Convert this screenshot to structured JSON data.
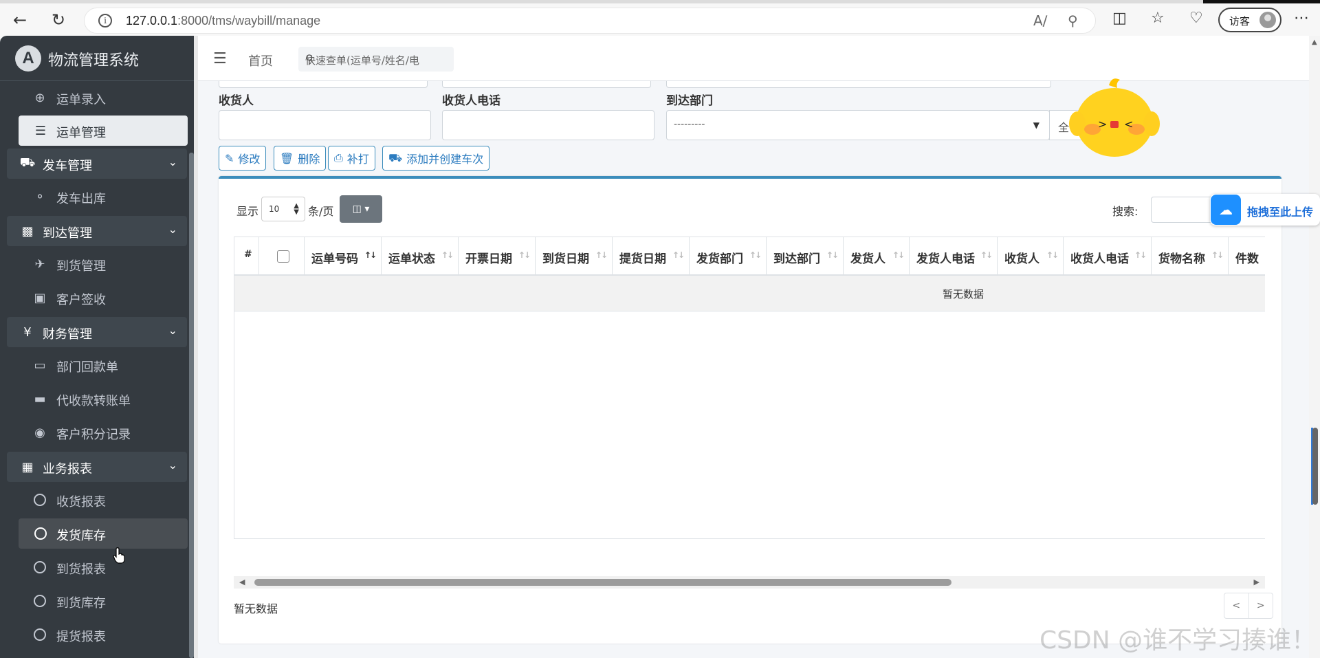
{
  "browser": {
    "url_host": "127.0.0.1",
    "url_path": ":8000/tms/waybill/manage",
    "guest_label": "访客"
  },
  "sidebar": {
    "brand": "物流管理系统",
    "items": [
      {
        "label": "运单录入",
        "icon": "plus-circle-icon"
      },
      {
        "label": "运单管理",
        "icon": "list-icon"
      },
      {
        "label": "发车管理",
        "icon": "truck-icon"
      },
      {
        "label": "发车出库",
        "icon": "vehicle-icon"
      },
      {
        "label": "到达管理",
        "icon": "dolly-icon"
      },
      {
        "label": "到货管理",
        "icon": "plane-landing-icon"
      },
      {
        "label": "客户签收",
        "icon": "box-open-icon"
      },
      {
        "label": "财务管理",
        "icon": "yen-icon"
      },
      {
        "label": "部门回款单",
        "icon": "money-bill-icon"
      },
      {
        "label": "代收款转账单",
        "icon": "credit-card-icon"
      },
      {
        "label": "客户积分记录",
        "icon": "coin-hand-icon"
      },
      {
        "label": "业务报表",
        "icon": "table-icon"
      },
      {
        "label": "收货报表",
        "icon": "circle-icon"
      },
      {
        "label": "发货库存",
        "icon": "circle-icon"
      },
      {
        "label": "到货报表",
        "icon": "circle-icon"
      },
      {
        "label": "到货库存",
        "icon": "circle-icon"
      },
      {
        "label": "提货报表",
        "icon": "circle-icon"
      }
    ]
  },
  "topnav": {
    "home": "首页",
    "quick_search_placeholder": "快速查单(运单号/姓名/电"
  },
  "filters": {
    "consignee_label": "收货人",
    "consignee_phone_label": "收货人电话",
    "arrival_dept_label": "到达部门",
    "arrival_dept_value": "---------",
    "all_button": "全"
  },
  "actions": {
    "edit": "修改",
    "delete": "删除",
    "reprint": "补打",
    "add_and_create_trip": "添加并创建车次"
  },
  "table": {
    "show_label": "显示",
    "page_size": "10",
    "per_page_label": "条/页",
    "search_label": "搜索:",
    "columns": [
      "#",
      "",
      "运单号码",
      "运单状态",
      "开票日期",
      "到货日期",
      "提货日期",
      "发货部门",
      "到达部门",
      "发货人",
      "发货人电话",
      "收货人",
      "收货人电话",
      "货物名称",
      "件数"
    ],
    "empty_row": "暂无数据",
    "footer_info": "暂无数据",
    "pager_prev": "<",
    "pager_next": ">"
  },
  "overlays": {
    "upload_label": "拖拽至此上传",
    "watermark": "CSDN @谁不学习揍谁！"
  },
  "colors": {
    "sidebar_bg": "#343a40",
    "primary": "#3c8dbc",
    "upload_blue": "#1e90ff"
  }
}
